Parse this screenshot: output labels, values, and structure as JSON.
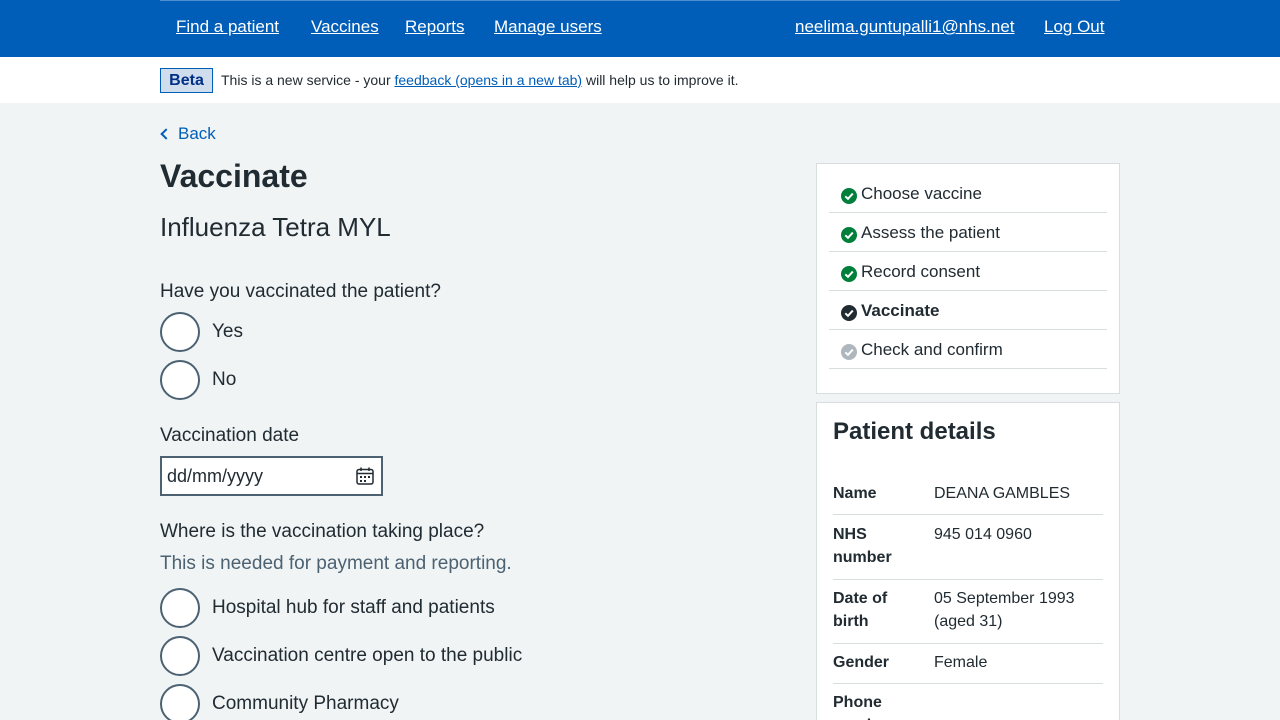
{
  "header": {
    "nav": [
      "Find a patient",
      "Vaccines",
      "Reports",
      "Manage users"
    ],
    "user_email": "neelima.guntupalli1@nhs.net",
    "logout": "Log Out",
    "color": "#005eb8"
  },
  "beta": {
    "tag": "Beta",
    "text_before": "This is a new service - your ",
    "link": "feedback (opens in a new tab)",
    "text_after": " will help us to improve it."
  },
  "back": "Back",
  "page": {
    "title": "Vaccinate",
    "vaccine": "Influenza Tetra MYL"
  },
  "form": {
    "vaccinated_question": "Have you vaccinated the patient?",
    "vaccinated_options": [
      "Yes",
      "No"
    ],
    "date_label": "Vaccination date",
    "date_placeholder": "dd/mm/yyyy",
    "location_question": "Where is the vaccination taking place?",
    "location_hint": "This is needed for payment and reporting.",
    "location_options": [
      "Hospital hub for staff and patients",
      "Vaccination centre open to the public",
      "Community Pharmacy"
    ]
  },
  "steps": [
    {
      "label": "Choose vaccine",
      "status": "done",
      "icon": "check-circle-green-icon"
    },
    {
      "label": "Assess the patient",
      "status": "done",
      "icon": "check-circle-green-icon"
    },
    {
      "label": "Record consent",
      "status": "done",
      "icon": "check-circle-green-icon"
    },
    {
      "label": "Vaccinate",
      "status": "current",
      "icon": "check-circle-dark-icon"
    },
    {
      "label": "Check and confirm",
      "status": "pending",
      "icon": "check-circle-grey-icon"
    }
  ],
  "patient": {
    "title": "Patient details",
    "rows": [
      {
        "key": "Name",
        "value": "DEANA GAMBLES"
      },
      {
        "key": "NHS number",
        "value": "945 014 0960"
      },
      {
        "key": "Date of birth",
        "value": "05 September 1993 (aged 31)"
      },
      {
        "key": "Gender",
        "value": "Female"
      },
      {
        "key": "Phone number",
        "value": ""
      }
    ]
  }
}
